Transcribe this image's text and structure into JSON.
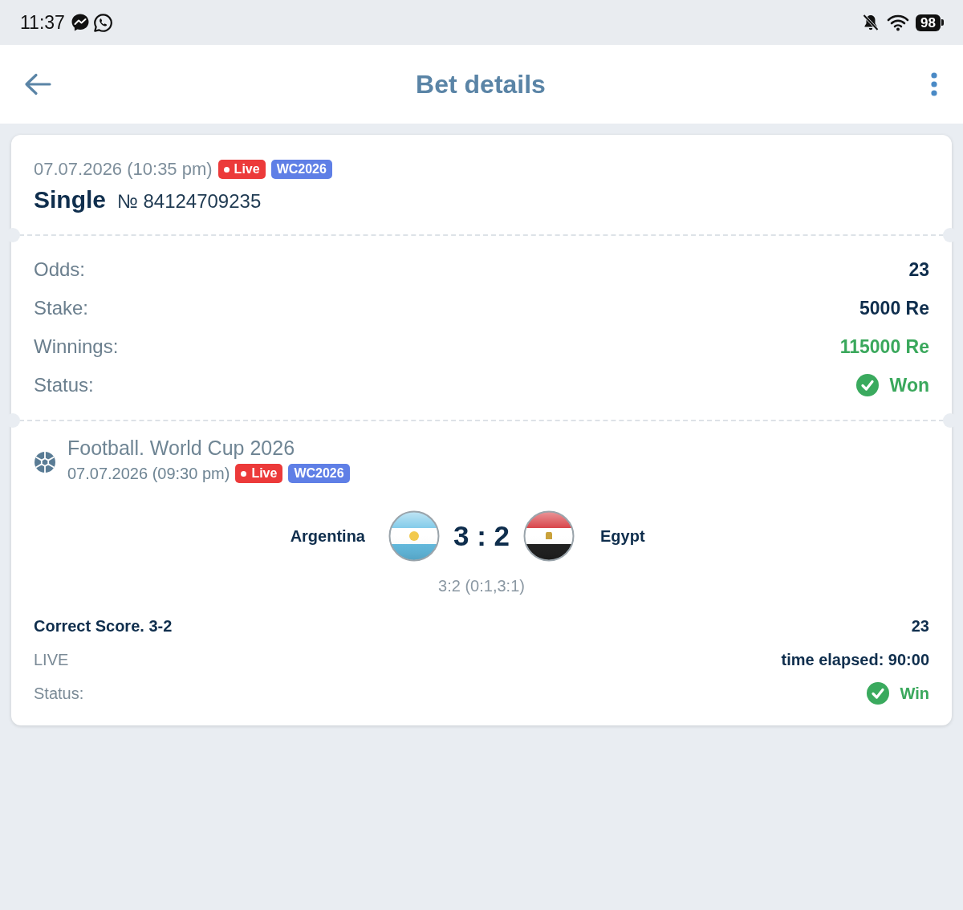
{
  "status_bar": {
    "time": "11:37",
    "battery": "98"
  },
  "header": {
    "title": "Bet details"
  },
  "bet": {
    "date": "07.07.2026 (10:35 pm)",
    "badges": [
      {
        "kind": "live",
        "label": "Live"
      },
      {
        "kind": "tag",
        "label": "WC2026"
      }
    ],
    "type": "Single",
    "number": "№ 84124709235"
  },
  "summary": [
    {
      "kind": "plain",
      "label": "Odds:",
      "value": "23"
    },
    {
      "kind": "plain",
      "label": "Stake:",
      "value": "5000 Re"
    },
    {
      "kind": "payout",
      "label": "Winnings:",
      "value": "115000 Re"
    },
    {
      "kind": "status",
      "label": "Status:",
      "value": "Won"
    }
  ],
  "event": {
    "title": "Football. World Cup 2026",
    "date": "07.07.2026 (09:30 pm)",
    "badges": [
      {
        "kind": "live",
        "label": "Live"
      },
      {
        "kind": "tag",
        "label": "WC2026"
      }
    ],
    "home_team": "Argentina",
    "score": "3 : 2",
    "away_team": "Egypt",
    "score_detail": "3:2 (0:1,3:1)",
    "rows": [
      {
        "kind": "market",
        "label": "Correct Score. 3-2",
        "value": "23"
      },
      {
        "kind": "info",
        "label": "LIVE",
        "value": "time elapsed: 90:00"
      },
      {
        "kind": "status",
        "label": "Status:",
        "value": "Win"
      }
    ]
  }
}
